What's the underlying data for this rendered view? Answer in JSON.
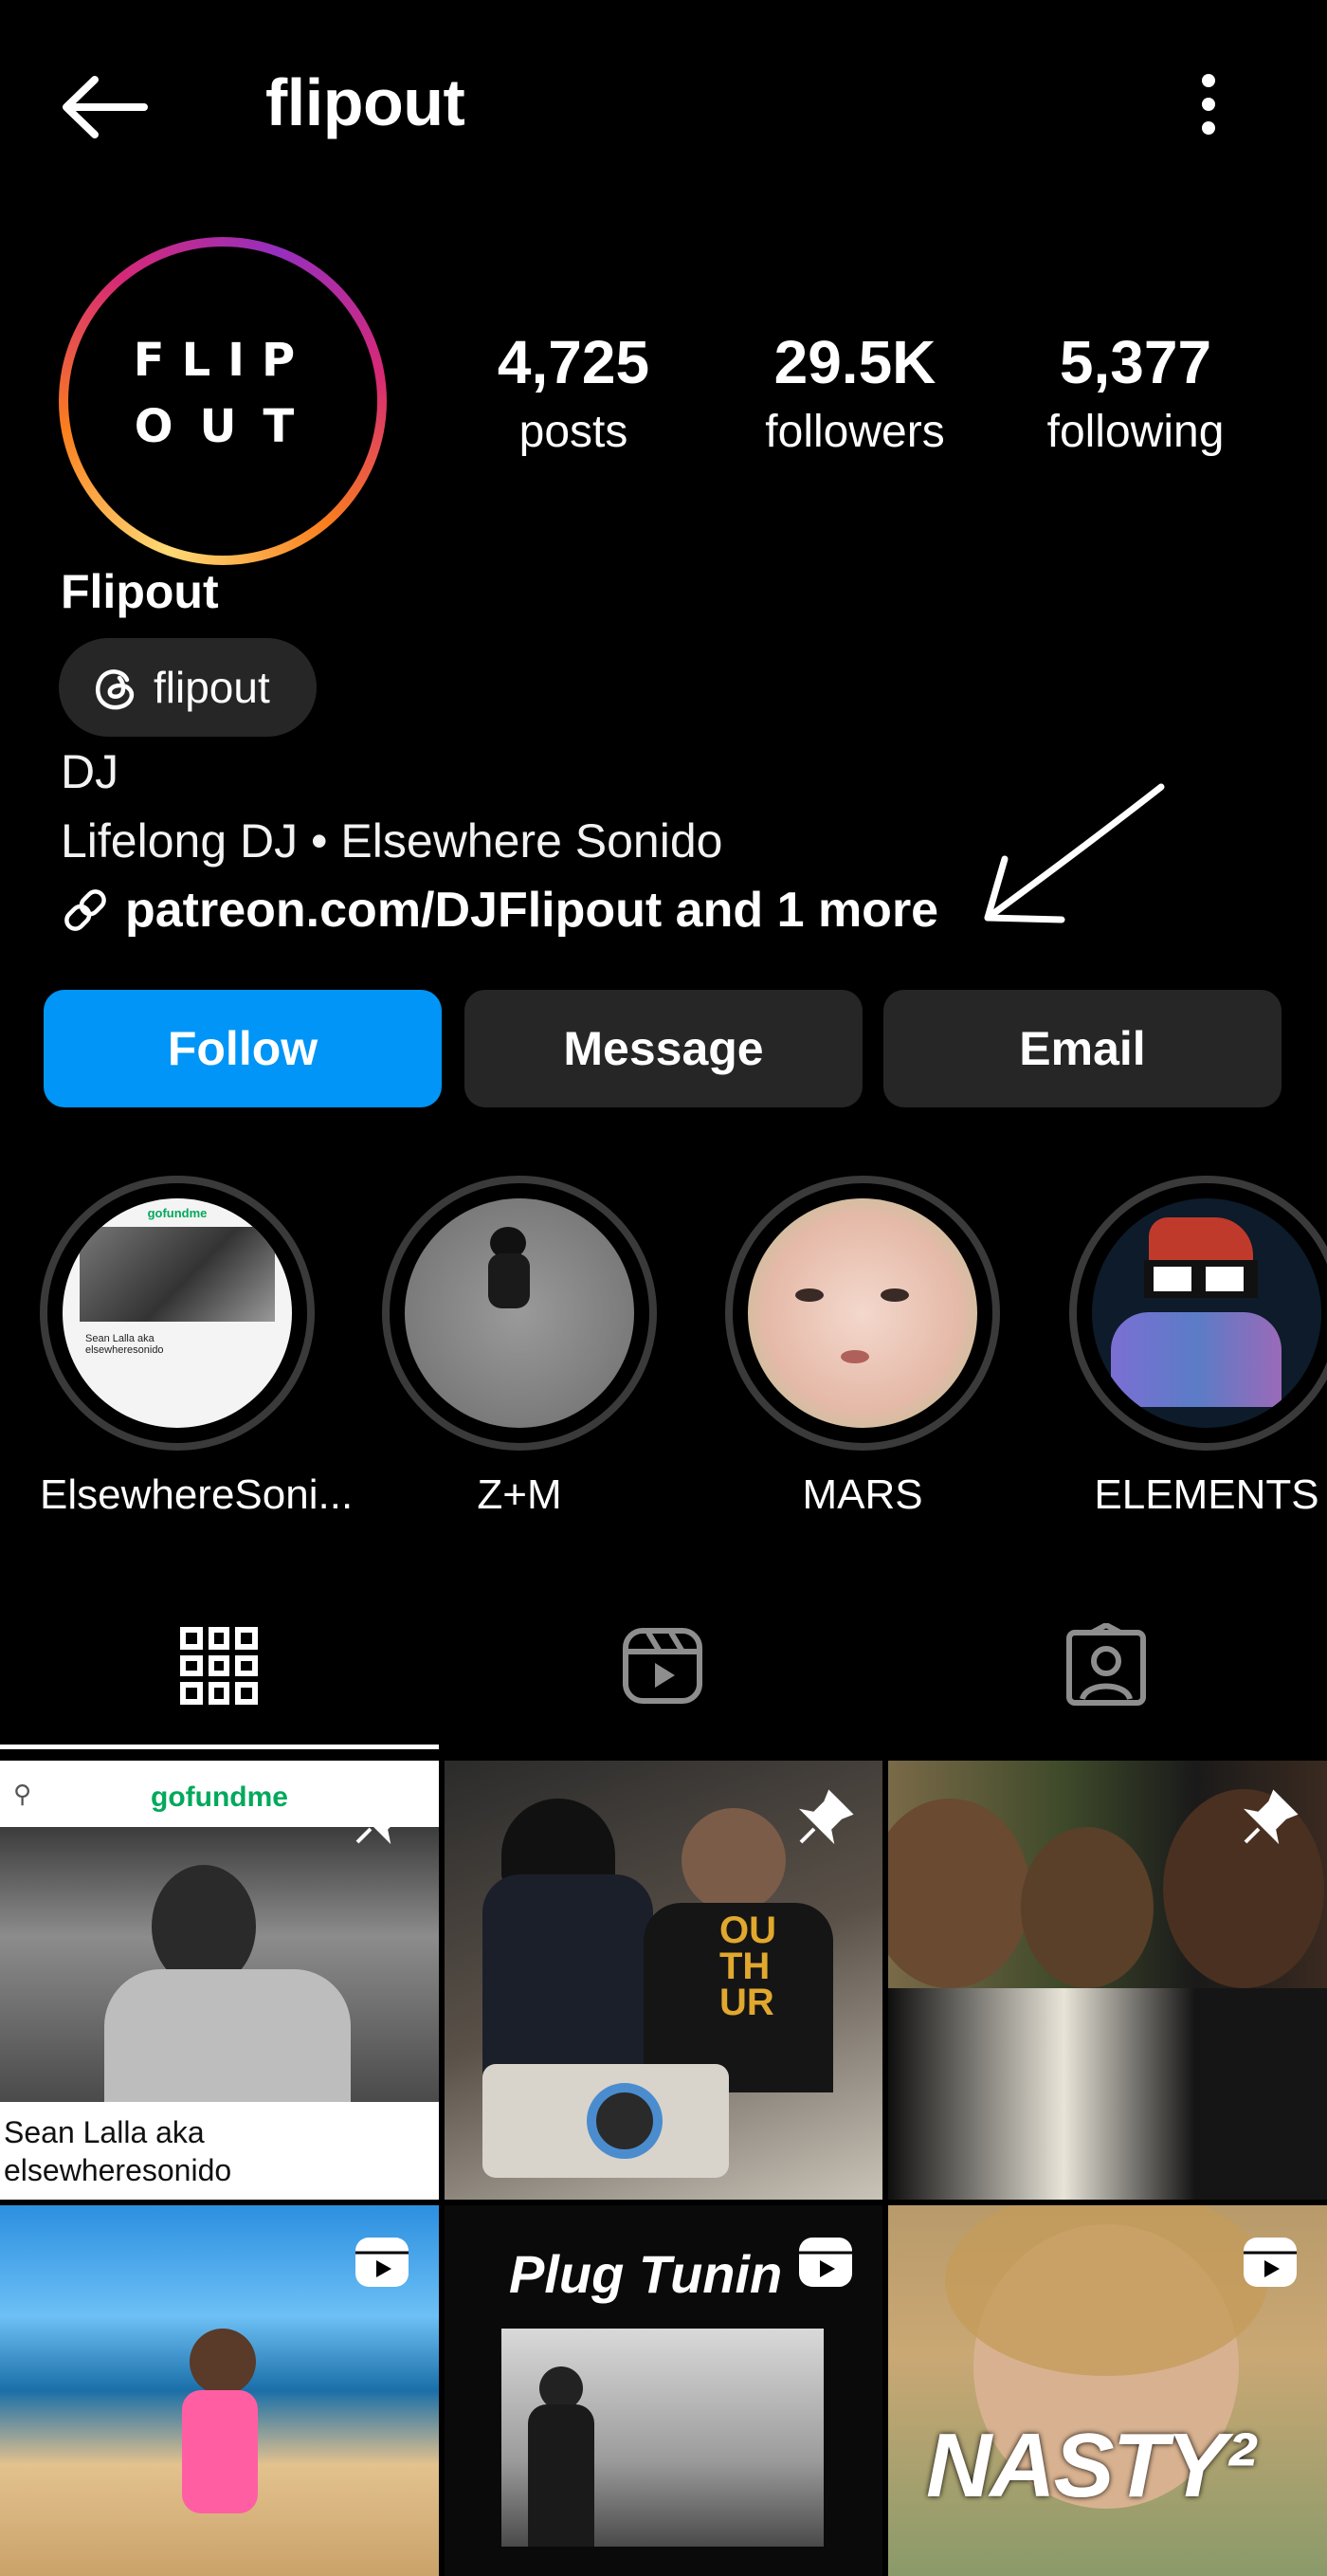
{
  "header": {
    "username": "flipout",
    "back_icon": "arrow-left-icon",
    "menu_icon": "more-vertical-icon"
  },
  "profile": {
    "avatar_logo_line1": "FLIP",
    "avatar_logo_line2": "OUT",
    "display_name": "Flipout",
    "threads_handle": "flipout",
    "category": "DJ",
    "bio": "Lifelong DJ • Elsewhere Sonido",
    "link": "patreon.com/DJFlipout and 1 more"
  },
  "stats": [
    {
      "value": "4,725",
      "label": "posts"
    },
    {
      "value": "29.5K",
      "label": "followers"
    },
    {
      "value": "5,377",
      "label": "following"
    }
  ],
  "actions": {
    "follow": "Follow",
    "message": "Message",
    "email": "Email"
  },
  "highlights": [
    {
      "label": "ElsewhereSoni..."
    },
    {
      "label": "Z+M"
    },
    {
      "label": "MARS"
    },
    {
      "label": "ELEMENTS"
    }
  ],
  "tabs": [
    {
      "icon": "grid-icon",
      "active": true
    },
    {
      "icon": "reels-icon",
      "active": false
    },
    {
      "icon": "tagged-icon",
      "active": false
    }
  ],
  "posts": [
    {
      "type": "pinned",
      "brand": "gofundme",
      "caption_line1": "Sean Lalla aka",
      "caption_line2": "elsewheresonido"
    },
    {
      "type": "pinned",
      "shirt_text": "OU TH UR"
    },
    {
      "type": "pinned"
    },
    {
      "type": "reel"
    },
    {
      "type": "reel",
      "overlay_text": "Plug Tunin"
    },
    {
      "type": "reel",
      "overlay_text": "NASTY²"
    }
  ],
  "colors": {
    "background": "#000000",
    "follow_button": "#0095f6",
    "secondary_button": "#262626",
    "text": "#ffffff"
  }
}
